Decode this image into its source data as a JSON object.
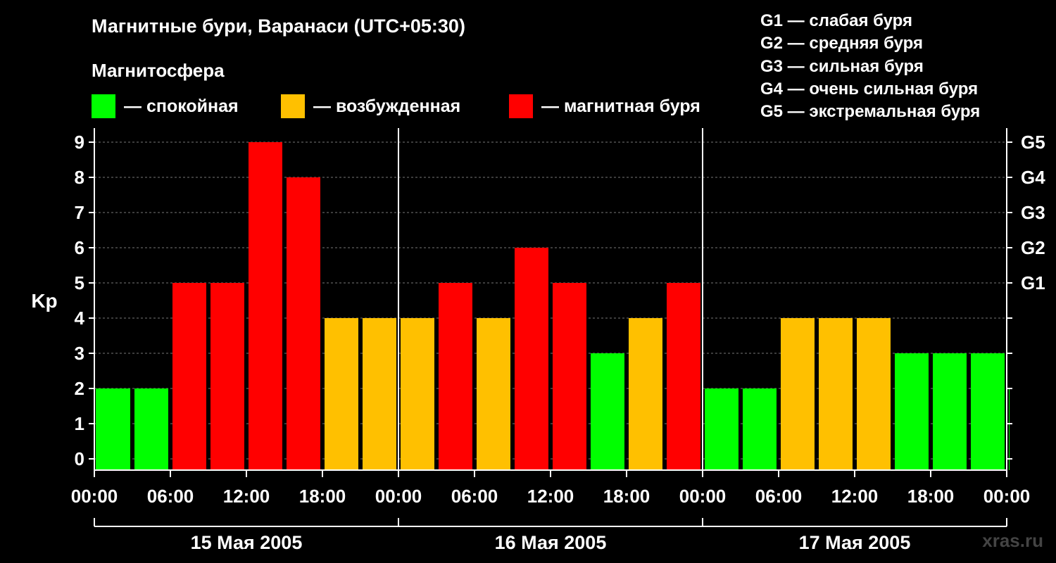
{
  "title": "Магнитные бури, Варанаси (UTC+05:30)",
  "magnetosphere": {
    "title": "Магнитосфера",
    "legend": [
      {
        "color": "#00ff00",
        "label": "— спокойная"
      },
      {
        "color": "#ffc000",
        "label": "— возбужденная"
      },
      {
        "color": "#ff0000",
        "label": "— магнитная буря"
      }
    ]
  },
  "g_scale": [
    "G1 — слабая буря",
    "G2 — средняя буря",
    "G3 — сильная буря",
    "G4 — очень сильная буря",
    "G5 — экстремальная буря"
  ],
  "watermark": "xras.ru",
  "chart_data": {
    "type": "bar",
    "ylabel": "Kp",
    "ylim": [
      0,
      9
    ],
    "yticks": [
      0,
      1,
      2,
      3,
      4,
      5,
      6,
      7,
      8,
      9
    ],
    "right_ticks": [
      {
        "value": 5,
        "label": "G1"
      },
      {
        "value": 6,
        "label": "G2"
      },
      {
        "value": 7,
        "label": "G3"
      },
      {
        "value": 8,
        "label": "G4"
      },
      {
        "value": 9,
        "label": "G5"
      }
    ],
    "x_tick_labels": [
      "00:00",
      "06:00",
      "12:00",
      "18:00",
      "00:00",
      "06:00",
      "12:00",
      "18:00",
      "00:00",
      "06:00",
      "12:00",
      "18:00",
      "00:00"
    ],
    "days": [
      "15 Мая 2005",
      "16 Мая 2005",
      "17 Мая 2005"
    ],
    "level_colors": {
      "quiet": "#00ff00",
      "active": "#ffc000",
      "storm": "#ff0000"
    },
    "values": [
      2,
      2,
      5,
      5,
      9,
      8,
      4,
      4,
      4,
      5,
      4,
      6,
      5,
      3,
      4,
      5,
      2,
      2,
      4,
      4,
      4,
      3,
      3,
      3,
      2
    ],
    "grid": "dashed horizontal"
  }
}
